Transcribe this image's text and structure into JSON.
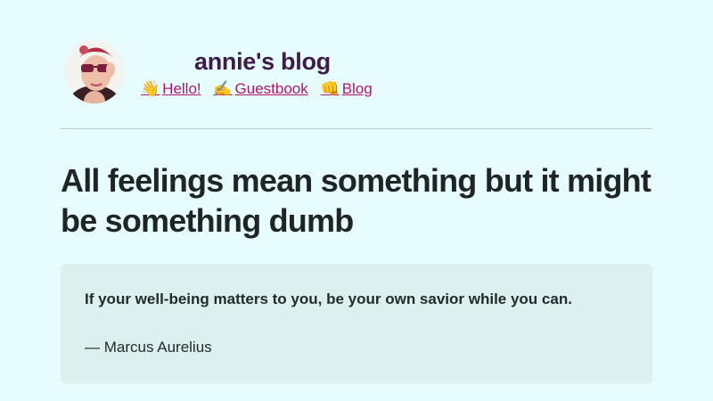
{
  "header": {
    "site_title": "annie's blog",
    "avatar_alt": "annie avatar",
    "nav": [
      {
        "emoji": "👋",
        "label": "Hello!"
      },
      {
        "emoji": "✍️",
        "label": "Guestbook"
      },
      {
        "emoji": "👊",
        "label": "Blog"
      }
    ]
  },
  "post": {
    "title": "All feelings mean something but it might be something dumb",
    "quote": {
      "text": "If your well-being matters to you, be your own savior while you can.",
      "attribution": "— Marcus Aurelius"
    }
  },
  "colors": {
    "background": "#e6fcff",
    "title": "#3d1c4a",
    "link": "#b1166e",
    "quote_bg": "#dcf0f0"
  }
}
